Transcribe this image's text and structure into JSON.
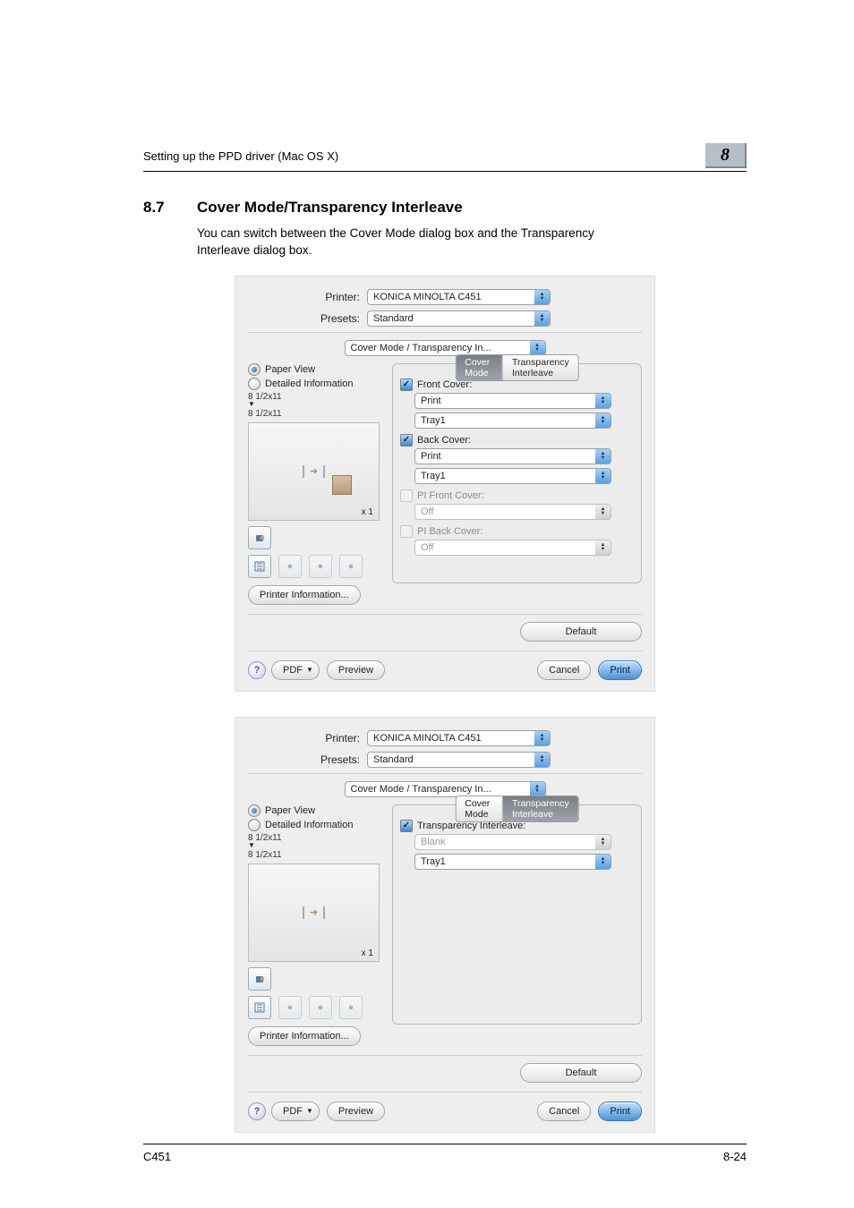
{
  "header": {
    "title": "Setting up the PPD driver (Mac OS X)",
    "chapter": "8"
  },
  "section": {
    "number": "8.7",
    "title": "Cover Mode/Transparency Interleave"
  },
  "body_line1": "You can switch between the Cover Mode dialog box and the Transparency",
  "body_line2": "Interleave dialog box.",
  "common": {
    "printer_label": "Printer:",
    "printer_value": "KONICA MINOLTA C451",
    "presets_label": "Presets:",
    "presets_value": "Standard",
    "pane_value": "Cover Mode / Transparency In...",
    "paper_view": "Paper View",
    "detailed_info": "Detailed Information",
    "size1": "8 1/2x11",
    "size2": "8 1/2x11",
    "count": "x 1",
    "printer_info_btn": "Printer Information...",
    "default_btn": "Default",
    "pdf_btn": "PDF",
    "preview_btn": "Preview",
    "cancel_btn": "Cancel",
    "print_btn": "Print",
    "tab_cover": "Cover Mode",
    "tab_trans": "Transparency Interleave"
  },
  "dlg1": {
    "front_cover_lbl": "Front Cover:",
    "print1": "Print",
    "tray1a": "Tray1",
    "back_cover_lbl": "Back Cover:",
    "print2": "Print",
    "tray1b": "Tray1",
    "pi_front_lbl": "PI Front Cover:",
    "pi_front_val": "Off",
    "pi_back_lbl": "PI Back Cover:",
    "pi_back_val": "Off"
  },
  "dlg2": {
    "trans_lbl": "Transparency Interleave:",
    "blank": "Blank",
    "tray": "Tray1"
  },
  "footer": {
    "left": "C451",
    "right": "8-24"
  }
}
